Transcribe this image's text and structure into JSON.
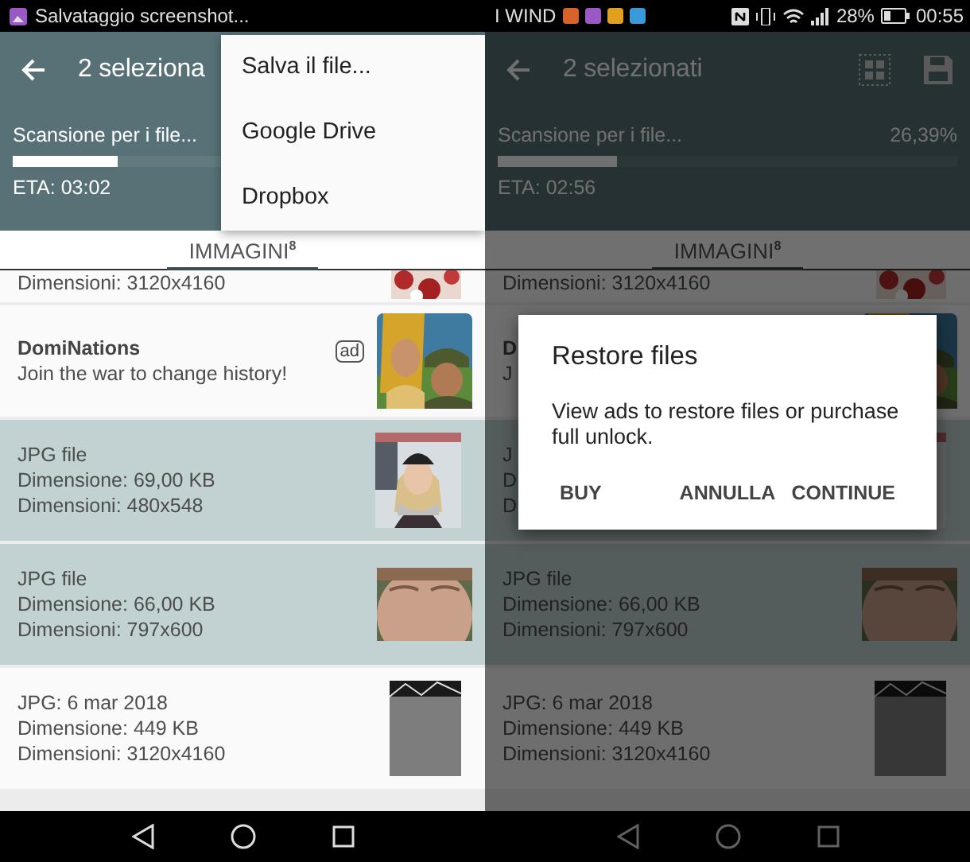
{
  "screens": [
    {
      "status_bar": {
        "notification": "Salvataggio screenshot..."
      },
      "toolbar": {
        "title": "2 seleziona"
      },
      "scan": {
        "label": "Scansione per i file...",
        "level": 0.23,
        "eta": "ETA: 03:02"
      },
      "tab": {
        "label": "IMMAGINI",
        "count": "8",
        "selected": true
      },
      "rows": [
        {
          "kind": "partial",
          "lines": [
            "Dimensioni: 3120x4160"
          ],
          "selected": false,
          "thumb": {
            "kind": "picture"
          }
        },
        {
          "kind": "ad",
          "title": "DomiNations",
          "subtitle": "Join the war to change history!",
          "badge": "ad",
          "selected": false,
          "thumb": {
            "kind": "picture"
          }
        },
        {
          "kind": "file",
          "lines": [
            "JPG file",
            "Dimensione: 69,00 KB",
            "Dimensioni: 480x548"
          ],
          "selected": true,
          "thumb": {
            "kind": "picture"
          }
        },
        {
          "kind": "file",
          "lines": [
            "JPG file",
            "Dimensione: 66,00 KB",
            "Dimensioni: 797x600"
          ],
          "selected": true,
          "thumb": {
            "kind": "picture"
          }
        },
        {
          "kind": "file",
          "lines": [
            "JPG: 6 mar 2018",
            "Dimensione: 449 KB",
            "Dimensioni: 3120x4160"
          ],
          "selected": false,
          "thumb": {
            "kind": "picture"
          }
        }
      ],
      "menu": {
        "items": [
          "Salva il file...",
          "Google Drive",
          "Dropbox"
        ]
      }
    },
    {
      "status_bar": {
        "carrier": "I WIND",
        "battery": "28%",
        "time": "00:55"
      },
      "toolbar": {
        "title": "2 selezionati"
      },
      "scan": {
        "label": "Scansione per i file...",
        "percent": "26,39%",
        "level": 0.26,
        "eta": "ETA: 02:56"
      },
      "tab": {
        "label": "IMMAGINI",
        "count": "8",
        "selected": true
      },
      "rows": [
        {
          "kind": "partial",
          "lines": [
            "Dimensioni: 3120x4160"
          ],
          "selected": false,
          "thumb": {
            "kind": "picture"
          }
        },
        {
          "kind": "ad",
          "title": "D",
          "subtitle": "J",
          "selected": false,
          "thumb": {
            "kind": "picture"
          }
        },
        {
          "kind": "file",
          "lines": [
            "J",
            "D",
            "D"
          ],
          "selected": true,
          "thumb": {
            "kind": "picture"
          }
        },
        {
          "kind": "file",
          "lines": [
            "JPG file",
            "Dimensione: 66,00 KB",
            "Dimensioni: 797x600"
          ],
          "selected": true,
          "thumb": {
            "kind": "picture"
          }
        },
        {
          "kind": "file",
          "lines": [
            "JPG: 6 mar 2018",
            "Dimensione: 449 KB",
            "Dimensioni: 3120x4160"
          ],
          "selected": false,
          "thumb": {
            "kind": "picture"
          }
        }
      ],
      "dialog": {
        "title": "Restore files",
        "message": "View ads to restore files or purchase full unlock.",
        "buttons": [
          "BUY",
          "ANNULLA",
          "CONTINUE"
        ]
      }
    }
  ]
}
